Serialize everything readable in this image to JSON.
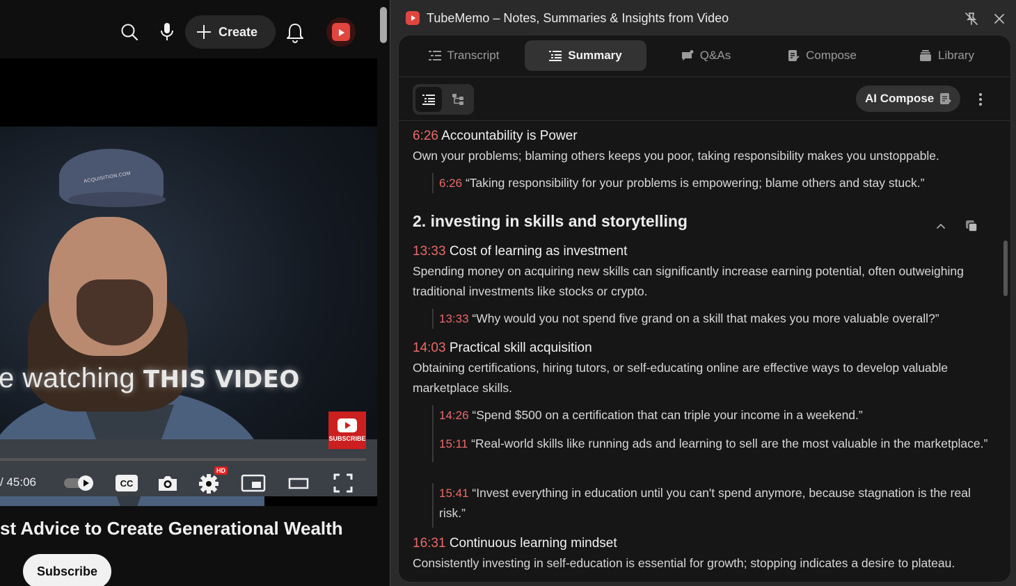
{
  "youtube": {
    "create_label": "Create",
    "time_display": "/ 45:06",
    "overlay_text_plain": "e watching",
    "overlay_text_bold": "THIS VIDEO",
    "subscribe_badge_label": "SUBSCRIBE",
    "hd_badge": "HD",
    "cc_label": "CC",
    "video_title": "st Advice to Create Generational Wealth",
    "subscribe_button": "Subscribe",
    "cap_logo_text": "ACQUISITION.COM"
  },
  "panel": {
    "app_title": "TubeMemo – Notes, Summaries & Insights from Video",
    "tabs": [
      {
        "label": "Transcript",
        "icon": "transcript-icon",
        "active": false
      },
      {
        "label": "Summary",
        "icon": "summary-icon",
        "active": true
      },
      {
        "label": "Q&As",
        "icon": "qa-icon",
        "active": false
      },
      {
        "label": "Compose",
        "icon": "compose-icon",
        "active": false
      },
      {
        "label": "Library",
        "icon": "library-icon",
        "active": false
      }
    ],
    "ai_compose_label": "AI Compose",
    "accent_color": "#ea6a6a",
    "items": {
      "p1": {
        "time": "6:26",
        "title": "Accountability is Power",
        "desc": "Own your problems; blaming others keeps you poor, taking responsibility makes you unstoppable.",
        "quote_time": "6:26",
        "quote": "“Taking responsibility for your problems is empowering; blame others and stay stuck.”"
      },
      "section2_title": "2. investing in skills and storytelling",
      "p2": {
        "time": "13:33",
        "title": "Cost of learning as investment",
        "desc": "Spending money on acquiring new skills can significantly increase earning potential, often outweighing traditional investments like stocks or crypto.",
        "quote_time": "13:33",
        "quote": "“Why would you not spend five grand on a skill that makes you more valuable overall?”"
      },
      "p3": {
        "time": "14:03",
        "title": "Practical skill acquisition",
        "desc": "Obtaining certifications, hiring tutors, or self-educating online are effective ways to develop valuable marketplace skills.",
        "q1_time": "14:26",
        "q1": "“Spend $500 on a certification that can triple your income in a weekend.”",
        "q2_time": "15:11",
        "q2": "“Real-world skills like running ads and learning to sell are the most valuable in the marketplace.”",
        "q3_time": "15:41",
        "q3": "“Invest everything in education until you can't spend anymore, because stagnation is the real risk.”"
      },
      "p4": {
        "time": "16:31",
        "title": "Continuous learning mindset",
        "desc": "Consistently investing in self-education is essential for growth; stopping indicates a desire to plateau."
      }
    }
  }
}
